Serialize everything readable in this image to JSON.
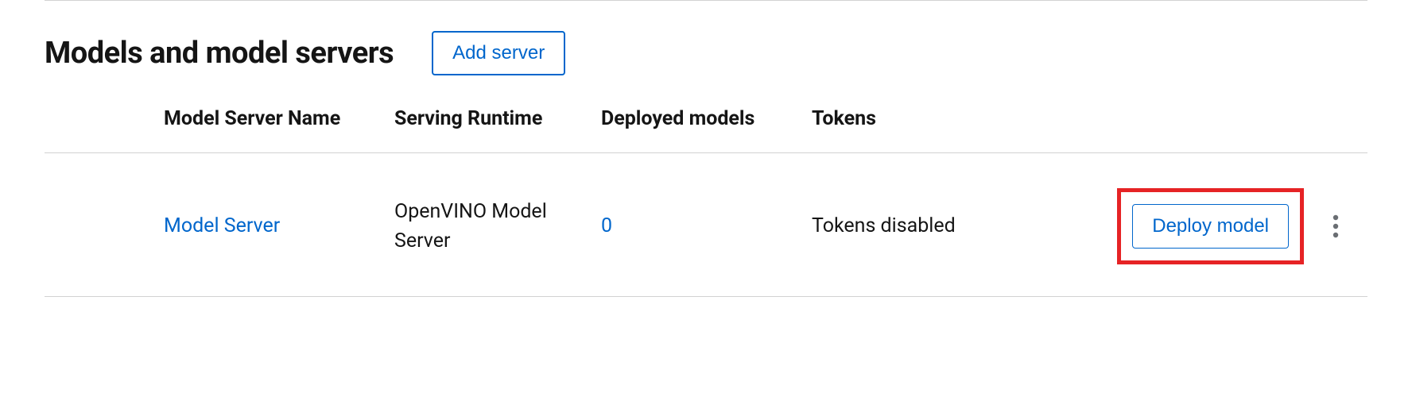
{
  "header": {
    "title": "Models and model servers",
    "add_server_label": "Add server"
  },
  "table": {
    "columns": {
      "name": "Model Server Name",
      "runtime": "Serving Runtime",
      "deployed": "Deployed models",
      "tokens": "Tokens"
    },
    "rows": [
      {
        "name": "Model Server",
        "runtime": "OpenVINO Model Server",
        "deployed": "0",
        "tokens": "Tokens disabled",
        "deploy_label": "Deploy model"
      }
    ]
  }
}
